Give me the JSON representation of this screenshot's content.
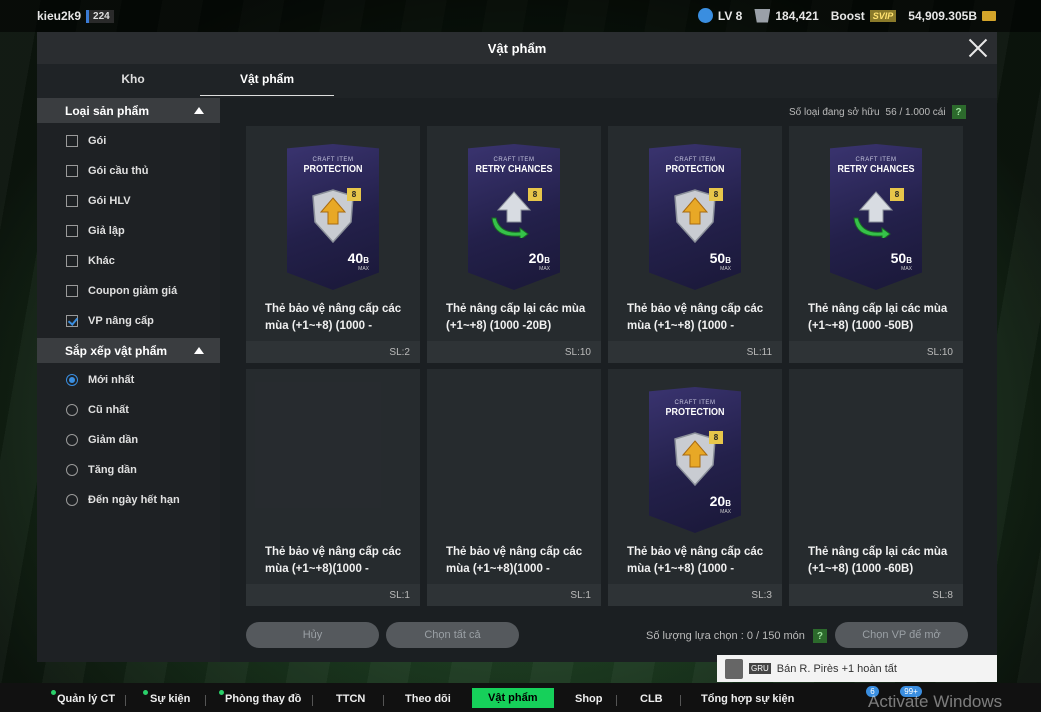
{
  "topbar": {
    "username": "kieu2k9",
    "user_level": "224",
    "lv": "LV 8",
    "points": "184,421",
    "boost_label": "Boost",
    "svip": "SVIP",
    "money": "54,909.305B"
  },
  "panel": {
    "title": "Vật phẩm",
    "tabs": [
      "Kho",
      "Vật phẩm"
    ],
    "owned_label": "Số loại đang sở hữu",
    "owned_value": "56 / 1.000 cái",
    "help": "?"
  },
  "sidebar": {
    "type_header": "Loại sản phẩm",
    "types": [
      "Gói",
      "Gói cầu thủ",
      "Gói HLV",
      "Giả lập",
      "Khác",
      "Coupon giảm giá",
      "VP nâng cấp"
    ],
    "checked": [
      false,
      false,
      false,
      false,
      false,
      false,
      true
    ],
    "sort_header": "Sắp xếp vật phẩm",
    "sorts": [
      "Mới nhất",
      "Cũ nhất",
      "Giảm dần",
      "Tăng dần",
      "Đến ngày hết hạn"
    ],
    "selected_sort": 0
  },
  "items": [
    {
      "card_small": "CRAFT ITEM",
      "card_big": "PROTECTION",
      "badge": "8",
      "num": "40",
      "unit": "B",
      "max": "MAX",
      "name1": "Thẻ bảo vệ nâng cấp các",
      "name2": "mùa (+1~+8) (1000 -",
      "qty": "SL:2"
    },
    {
      "card_small": "CRAFT ITEM",
      "card_big": "RETRY CHANCES",
      "badge": "8",
      "num": "20",
      "unit": "B",
      "max": "MAX",
      "name1": "Thẻ nâng cấp lại các mùa",
      "name2": "(+1~+8) (1000 -20B)",
      "qty": "SL:10"
    },
    {
      "card_small": "CRAFT ITEM",
      "card_big": "PROTECTION",
      "badge": "8",
      "num": "50",
      "unit": "B",
      "max": "MAX",
      "name1": "Thẻ bảo vệ nâng cấp các",
      "name2": "mùa (+1~+8) (1000 -",
      "qty": "SL:11"
    },
    {
      "card_small": "CRAFT ITEM",
      "card_big": "RETRY CHANCES",
      "badge": "8",
      "num": "50",
      "unit": "B",
      "max": "MAX",
      "name1": "Thẻ nâng cấp lại các mùa",
      "name2": "(+1~+8) (1000 -50B)",
      "qty": "SL:10"
    },
    {
      "name1": "Thẻ bảo vệ nâng cấp các",
      "name2": "mùa (+1~+8)(1000 -",
      "qty": "SL:1"
    },
    {
      "name1": "Thẻ bảo vệ nâng cấp các",
      "name2": "mùa (+1~+8)(1000 -",
      "qty": "SL:1"
    },
    {
      "card_small": "CRAFT ITEM",
      "card_big": "PROTECTION",
      "badge": "8",
      "num": "20",
      "unit": "B",
      "max": "MAX",
      "name1": "Thẻ bảo vệ nâng cấp các",
      "name2": "mùa (+1~+8) (1000 -",
      "qty": "SL:3"
    },
    {
      "name1": "Thẻ nâng cấp lại các mùa",
      "name2": "(+1~+8) (1000 -60B)",
      "qty": "SL:8"
    }
  ],
  "actions": {
    "cancel": "Hủy",
    "select_all": "Chọn tất cả",
    "selected_count": "Số lượng lựa chọn : 0 / 150 món",
    "open": "Chọn VP để mở"
  },
  "notification": {
    "tag": "GRU",
    "text": "Bán R. Pirès +1 hoàn tất"
  },
  "bottom_nav": [
    "Quản lý CT",
    "Sự kiện",
    "Phòng thay đồ",
    "TTCN",
    "Theo dõi",
    "Vật phẩm",
    "Shop",
    "CLB",
    "Tổng hợp sự kiện"
  ],
  "bottom_badges": {
    "mail": "6",
    "friends": "99+"
  },
  "watermark": "Activate Windows"
}
